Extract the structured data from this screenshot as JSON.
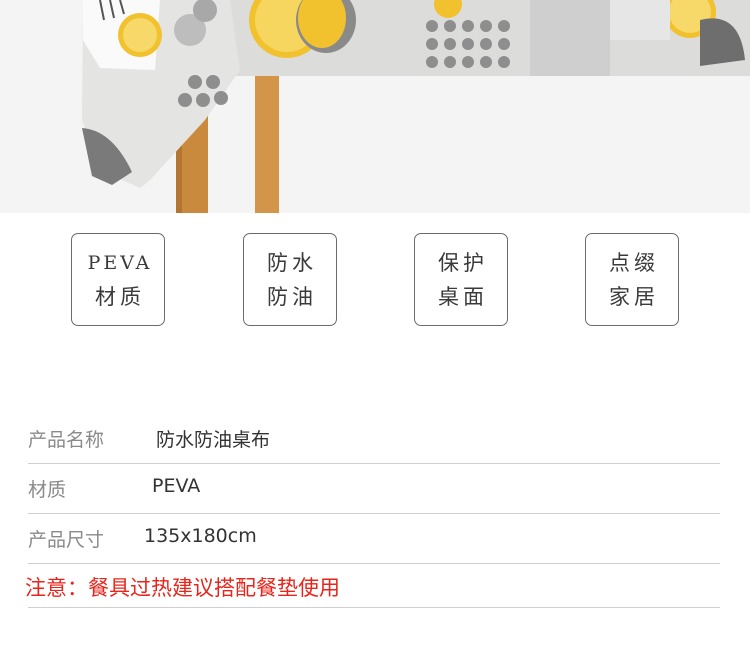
{
  "features": [
    {
      "line1": "PEVA",
      "line2": "材质"
    },
    {
      "line1": "防水",
      "line2": "防油"
    },
    {
      "line1": "保护",
      "line2": "桌面"
    },
    {
      "line1": "点缀",
      "line2": "家居"
    }
  ],
  "specs": [
    {
      "label": "产品名称",
      "value": "防水防油桌布"
    },
    {
      "label": "材质",
      "value": "PEVA"
    },
    {
      "label": "产品尺寸",
      "value": "135x180cm"
    }
  ],
  "notice": "注意：餐具过热建议搭配餐垫使用",
  "colors": {
    "accent_lemon": "#f2c12e",
    "gray_circle": "#8e8e8e",
    "notice_red": "#e8251b",
    "table_wood": "#c98a3e"
  }
}
